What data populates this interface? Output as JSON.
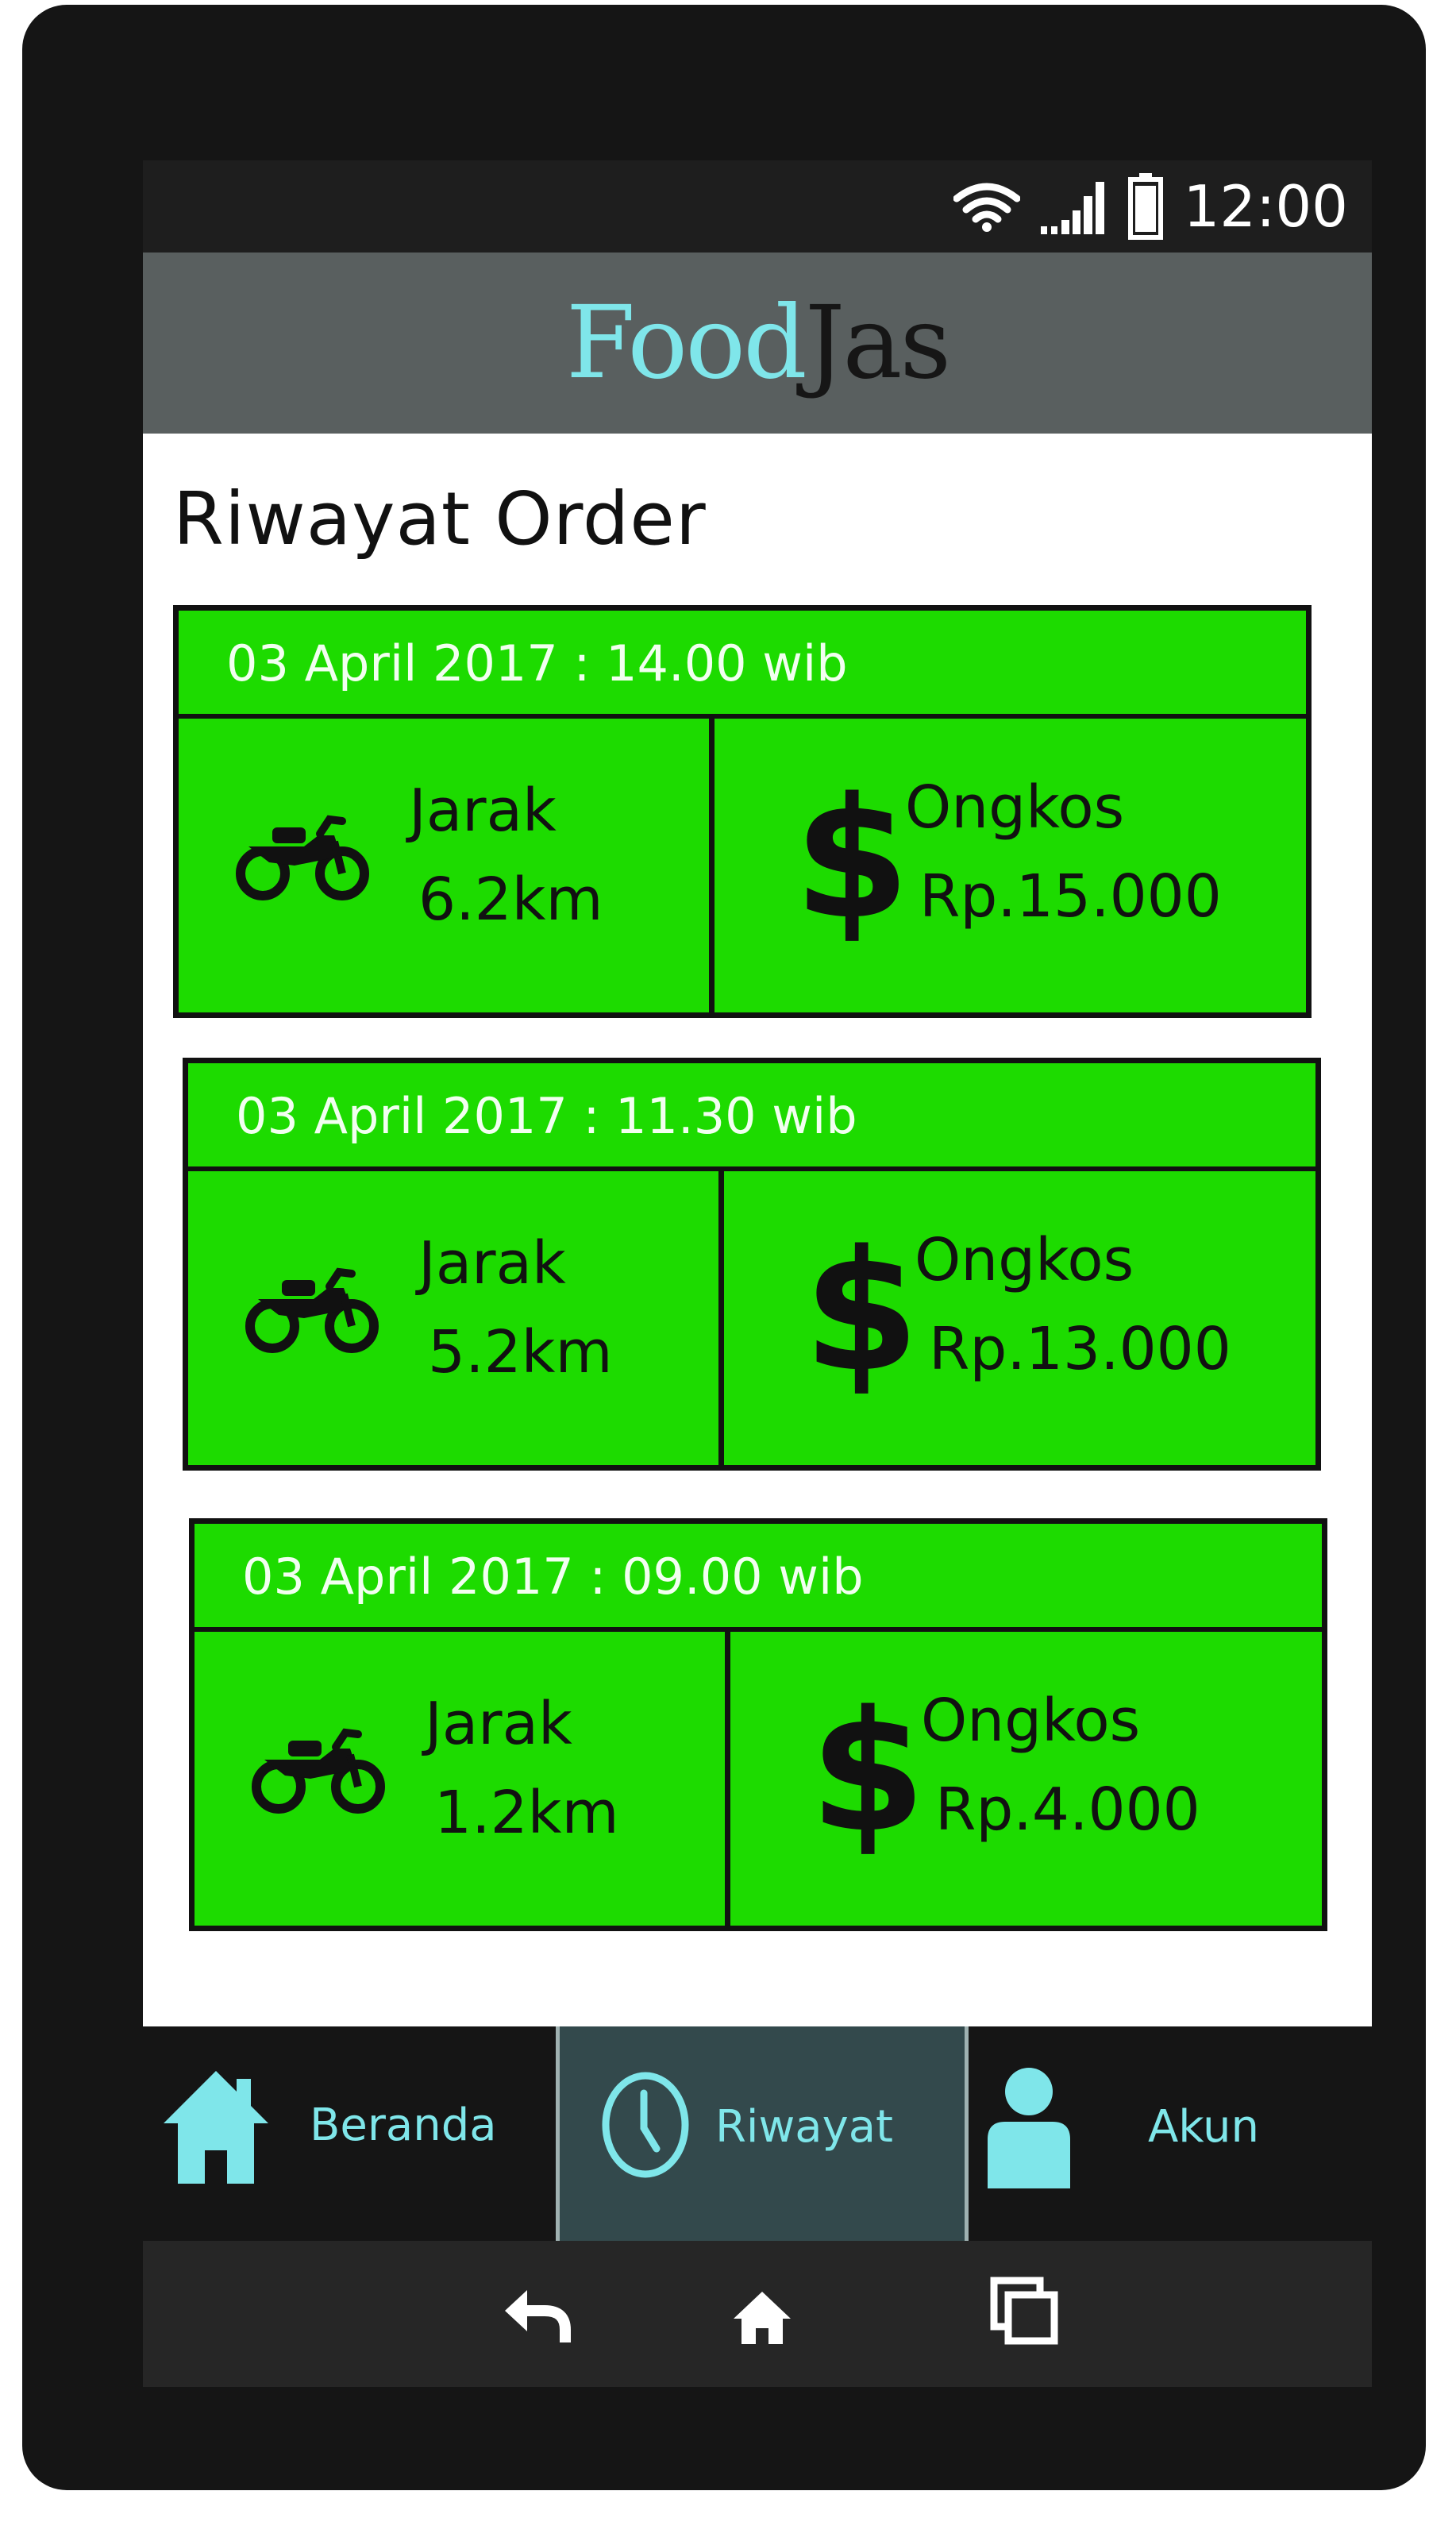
{
  "status_bar": {
    "time": "12:00",
    "icons": [
      "wifi-icon",
      "signal-icon",
      "battery-icon"
    ]
  },
  "app_bar": {
    "logo_part1": "Food",
    "logo_part2": "Jas"
  },
  "page_title": "Riwayat Order",
  "orders": [
    {
      "datetime": "03 April 2017 : 14.00 wib",
      "distance_label": "Jarak",
      "distance": "6.2km",
      "fee_label": "Ongkos",
      "fee": "Rp.15.000"
    },
    {
      "datetime": "03 April 2017 : 11.30 wib",
      "distance_label": "Jarak",
      "distance": "5.2km",
      "fee_label": "Ongkos",
      "fee": "Rp.13.000"
    },
    {
      "datetime": "03 April 2017 : 09.00 wib",
      "distance_label": "Jarak",
      "distance": "1.2km",
      "fee_label": "Ongkos",
      "fee": "Rp.4.000"
    }
  ],
  "bottom_nav": [
    {
      "label": "Beranda",
      "icon": "home-icon",
      "active": false
    },
    {
      "label": "Riwayat",
      "icon": "clock-icon",
      "active": true
    },
    {
      "label": "Akun",
      "icon": "user-icon",
      "active": false
    }
  ],
  "system_nav": [
    "back-icon",
    "home-icon",
    "recent-apps-icon"
  ],
  "colors": {
    "accent": "#7fe6ea",
    "card_green": "#1ddb00",
    "app_bar": "#595f5f",
    "active_tab": "#33494c",
    "phone_frame": "#151515"
  }
}
